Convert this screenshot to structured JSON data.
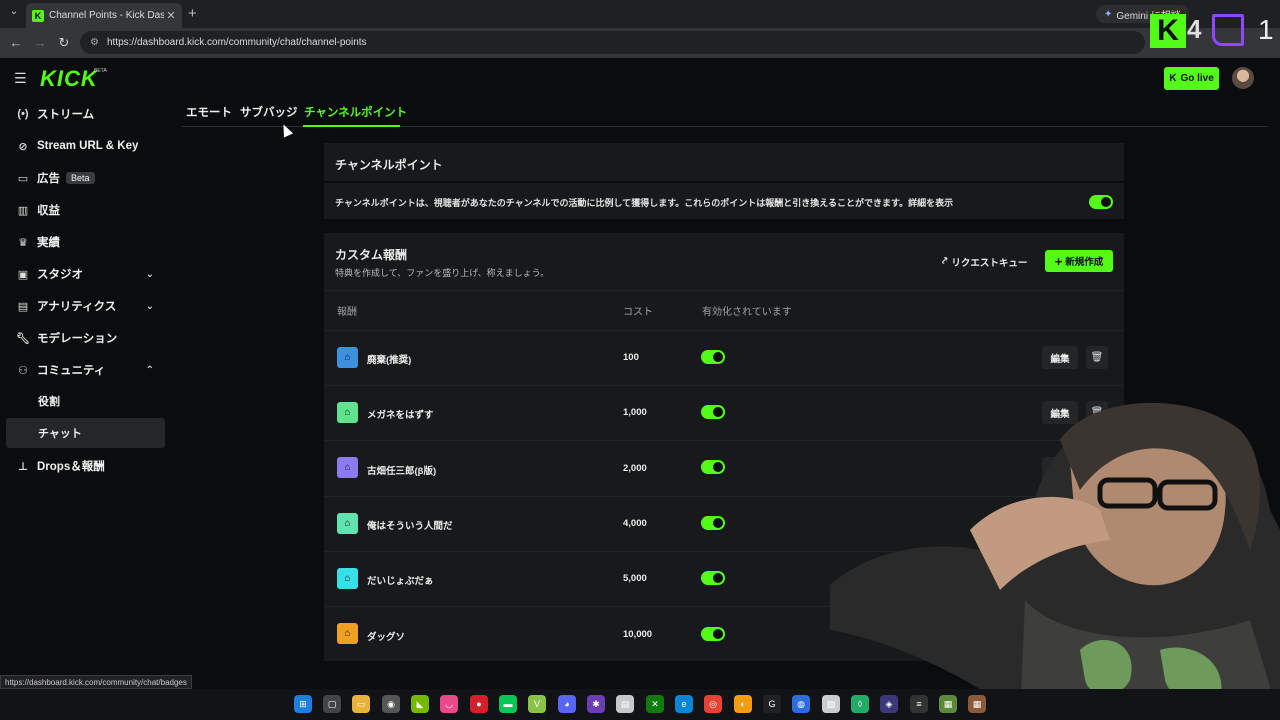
{
  "browser": {
    "tab_title": "Channel Points - Kick Dashboard",
    "tab_close": "✕",
    "new_tab": "+",
    "url": "https://dashboard.kick.com/community/chat/channel-points",
    "gemini_label": "Gemini に相談",
    "status_url": "https://dashboard.kick.com/community/chat/badges"
  },
  "overlay": {
    "kick_count": "4",
    "twitch_count": "1",
    "kick_color": "#53fc18",
    "twitch_color": "#9146ff"
  },
  "header": {
    "logo": "KICK",
    "logo_badge": "BETA",
    "go_live": "Go live"
  },
  "sidebar": {
    "items": [
      {
        "icon": "broadcast-icon",
        "label": "ストリーム"
      },
      {
        "icon": "link-icon",
        "label": "Stream URL & Key"
      },
      {
        "icon": "ad-icon",
        "label": "広告",
        "tag": "Beta"
      },
      {
        "icon": "revenue-icon",
        "label": "収益"
      },
      {
        "icon": "trophy-icon",
        "label": "実績"
      },
      {
        "icon": "studio-icon",
        "label": "スタジオ"
      },
      {
        "icon": "analytics-icon",
        "label": "アナリティクス"
      },
      {
        "icon": "wrench-icon",
        "label": "モデレーション"
      },
      {
        "icon": "community-icon",
        "label": "コミュニティ"
      },
      {
        "icon": "drops-icon",
        "label": "Drops＆報酬"
      }
    ],
    "community_sub": [
      "役割",
      "チャット"
    ]
  },
  "tabs": [
    "エモート",
    "サブバッジ",
    "チャンネルポイント"
  ],
  "channel_points": {
    "title": "チャンネルポイント",
    "description": "チャンネルポイントは、視聴者があなたのチャンネルでの活動に比例して獲得します。これらのポイントは報酬と引き換えることができます。詳細を表示",
    "enabled": true
  },
  "custom_rewards": {
    "title": "カスタム報酬",
    "subtitle": "特典を作成して、ファンを盛り上げ、称えましょう。",
    "request_queue": "リクエストキュー",
    "create_new": "新規作成",
    "columns": [
      "報酬",
      "コスト",
      "有効化されています"
    ],
    "edit_label": "編集",
    "rows": [
      {
        "name": "廃棄(推奨)",
        "cost": "100",
        "color": "#3d8fe0",
        "enabled": true
      },
      {
        "name": "メガネをはずす",
        "cost": "1,000",
        "color": "#5fe38d",
        "enabled": true
      },
      {
        "name": "古畑任三郎(β版)",
        "cost": "2,000",
        "color": "#8a7cf0",
        "enabled": true
      },
      {
        "name": "俺はそういう人間だ",
        "cost": "4,000",
        "color": "#5fe3b0",
        "enabled": true
      },
      {
        "name": "だいじょぶだぁ",
        "cost": "5,000",
        "color": "#37e0e8",
        "enabled": true
      },
      {
        "name": "ダッグソ",
        "cost": "10,000",
        "color": "#f0a020",
        "enabled": true
      }
    ]
  },
  "colors": {
    "accent": "#53fc18",
    "background": "#0b0c0d",
    "card": "#17191b"
  }
}
